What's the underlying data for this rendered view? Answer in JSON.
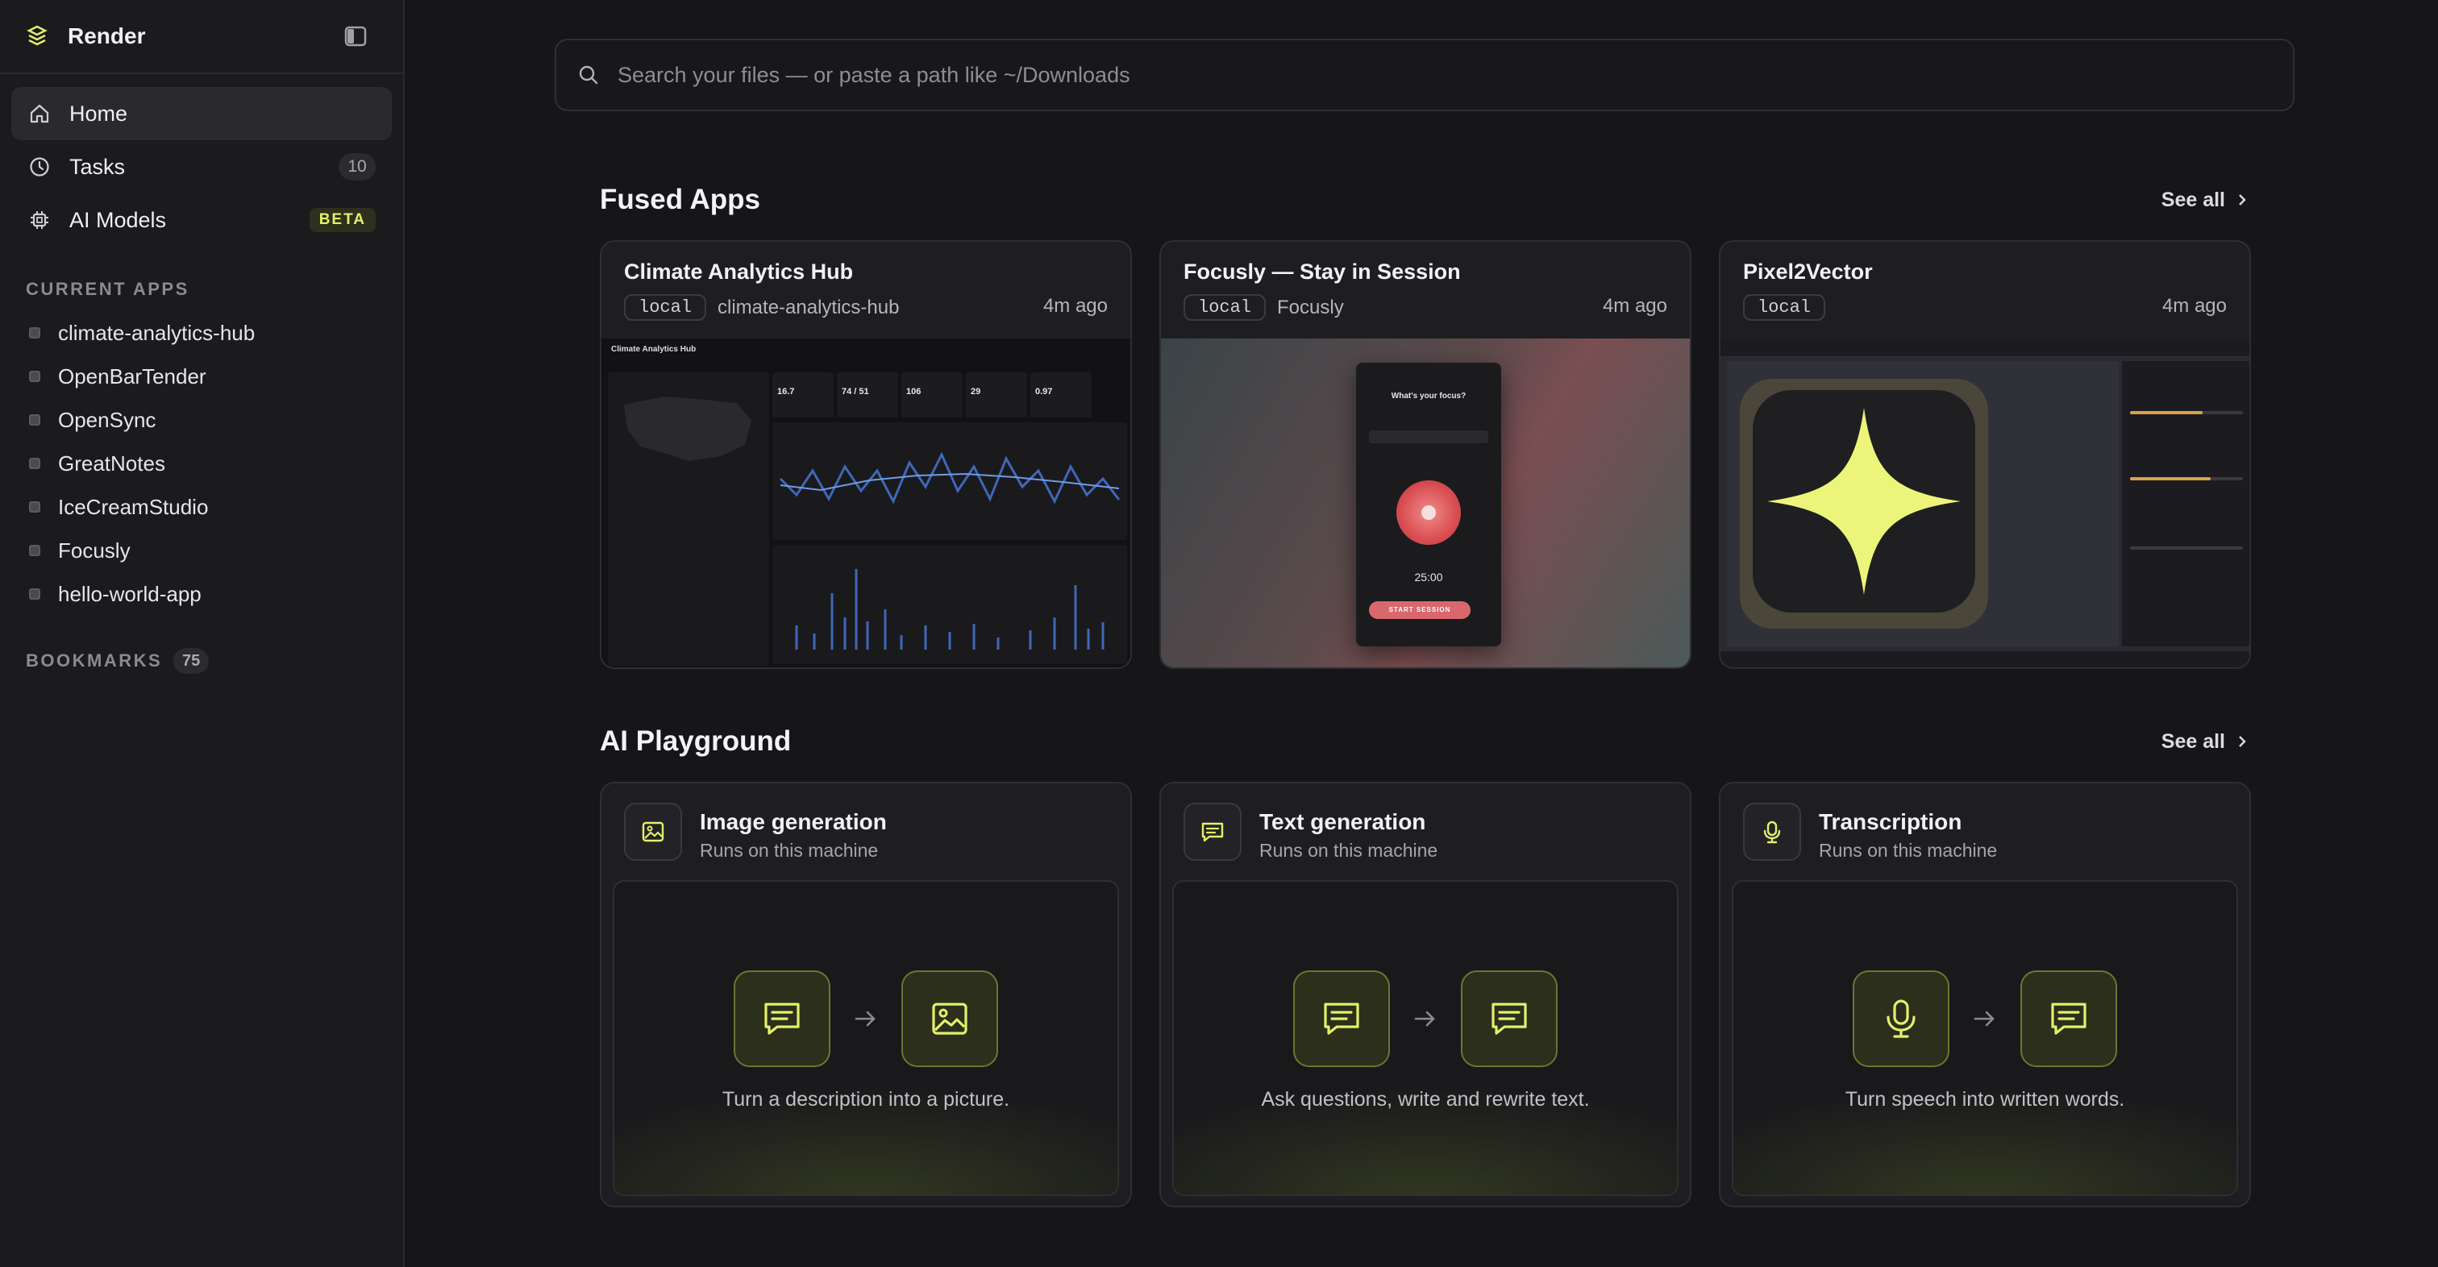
{
  "sidebar": {
    "brand": "Render",
    "nav": [
      {
        "label": "Home",
        "icon": "home-icon"
      },
      {
        "label": "Tasks",
        "icon": "clock-icon",
        "count": "10"
      },
      {
        "label": "AI Models",
        "icon": "chip-icon",
        "badge": "BETA"
      }
    ],
    "current_apps_title": "CURRENT APPS",
    "current_apps": [
      "climate-analytics-hub",
      "OpenBarTender",
      "OpenSync",
      "GreatNotes",
      "IceCreamStudio",
      "Focusly",
      "hello-world-app"
    ],
    "bookmarks_title": "BOOKMARKS",
    "bookmarks_count": "75"
  },
  "search": {
    "placeholder": "Search your files — or paste a path like ~/Downloads"
  },
  "fused_apps": {
    "title": "Fused Apps",
    "see_all": "See all",
    "cards": [
      {
        "title": "Climate Analytics Hub",
        "tag": "local",
        "slug": "climate-analytics-hub",
        "ago": "4m ago"
      },
      {
        "title": "Focusly — Stay in Session",
        "tag": "local",
        "slug": "Focusly",
        "ago": "4m ago"
      },
      {
        "title": "Pixel2Vector",
        "tag": "local",
        "slug": "",
        "ago": "4m ago"
      }
    ],
    "climate_preview": {
      "title": "Climate Analytics Hub",
      "stats": [
        "16.7",
        "74 / 51",
        "106",
        "29",
        "0.97"
      ]
    },
    "focusly_preview": {
      "question": "What's your focus?",
      "timer": "25:00",
      "start_label": "START SESSION"
    }
  },
  "ai_playground": {
    "title": "AI Playground",
    "see_all": "See all",
    "cards": [
      {
        "title": "Image generation",
        "sub": "Runs on this machine",
        "desc": "Turn a description into a picture.",
        "icon": "image-icon"
      },
      {
        "title": "Text generation",
        "sub": "Runs on this machine",
        "desc": "Ask questions, write and rewrite text.",
        "icon": "chat-icon"
      },
      {
        "title": "Transcription",
        "sub": "Runs on this machine",
        "desc": "Turn speech into written words.",
        "icon": "mic-icon"
      }
    ]
  },
  "colors": {
    "accent": "#e3f06a",
    "background": "#161619",
    "sidebar": "#1b1b1e"
  }
}
